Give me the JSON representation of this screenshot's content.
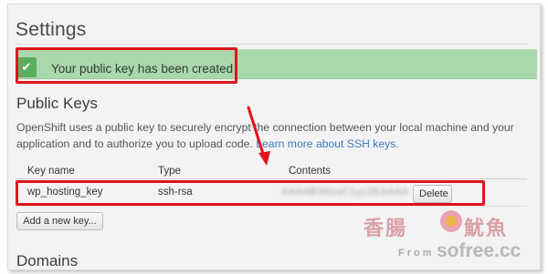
{
  "header": {
    "title": "Settings"
  },
  "alert": {
    "icon": "check-icon",
    "message": "Your public key has been created",
    "color": "#a9d8ac"
  },
  "public_keys": {
    "title": "Public Keys",
    "description": "OpenShift uses a public key to securely encrypt the connection between your local machine and your application and to authorize you to upload code.",
    "learn_more_link": "Learn more about SSH keys.",
    "columns": [
      "Key name",
      "Type",
      "Contents"
    ],
    "rows": [
      {
        "name": "wp_hosting_key",
        "type": "ssh-rsa",
        "contents": "AAAAB3NzaC1yc2EAAAA",
        "delete_label": "Delete"
      }
    ],
    "add_button_label": "Add a new key..."
  },
  "domains": {
    "title": "Domains"
  },
  "watermark": {
    "cn_left": "香腸",
    "cn_right": "魷魚",
    "from": "From",
    "site": "sofree.cc"
  },
  "annotation_color": "#e0141c"
}
